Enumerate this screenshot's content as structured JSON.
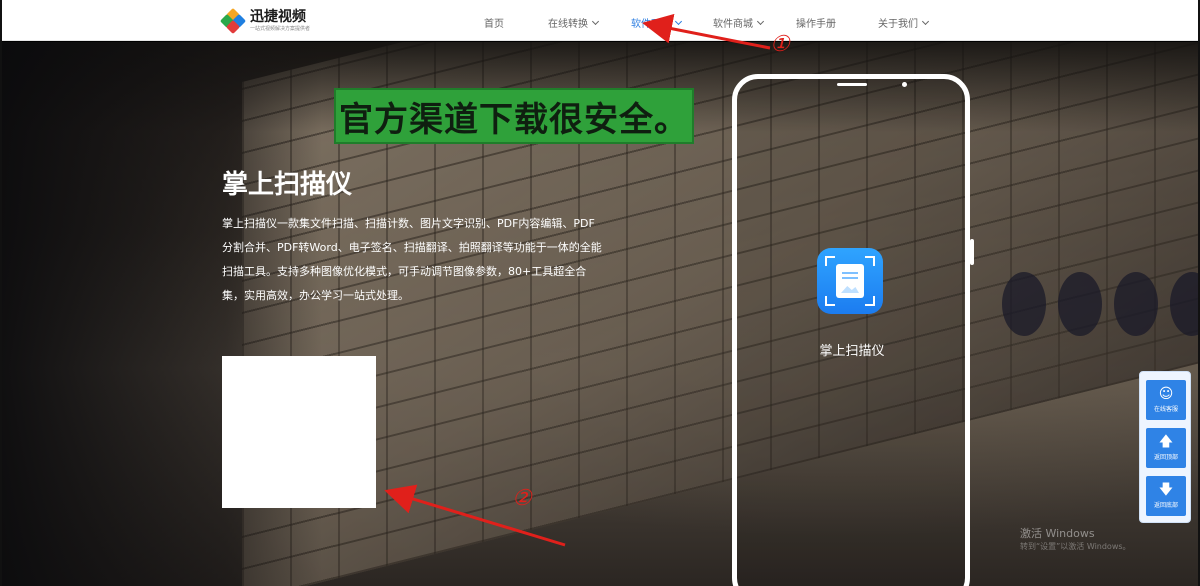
{
  "brand": {
    "title": "迅捷视频",
    "subtitle": "一站式视频解决方案提供者"
  },
  "nav": {
    "items": [
      {
        "label": "首页",
        "dropdown": false,
        "active": false
      },
      {
        "label": "在线转换",
        "dropdown": true,
        "active": false
      },
      {
        "label": "软件下载",
        "dropdown": true,
        "active": true
      },
      {
        "label": "软件商城",
        "dropdown": true,
        "active": false
      },
      {
        "label": "操作手册",
        "dropdown": false,
        "active": false
      },
      {
        "label": "关于我们",
        "dropdown": true,
        "active": false
      }
    ]
  },
  "hero": {
    "banner": "官方渠道下载很安全。",
    "title": "掌上扫描仪",
    "description": "掌上扫描仪一款集文件扫描、扫描计数、图片文字识别、PDF内容编辑、PDF分割合并、PDF转Word、电子签名、扫描翻译、拍照翻译等功能于一体的全能扫描工具。支持多种图像优化模式，可手动调节图像参数，80+工具超全合集，实用高效，办公学习一站式处理。",
    "app_name": "掌上扫描仪"
  },
  "side_panel": {
    "chat": "在线客服",
    "top": "返回顶部",
    "bottom": "返回底部"
  },
  "watermark": {
    "line1": "激活 Windows",
    "line2": "转到“设置”以激活 Windows。"
  },
  "annotations": {
    "one": "①",
    "two": "②"
  },
  "colors": {
    "accent": "#2b7de1",
    "banner_green": "#2fa13a",
    "annotation_red": "#e0201b",
    "side_button": "#2f83e6"
  }
}
